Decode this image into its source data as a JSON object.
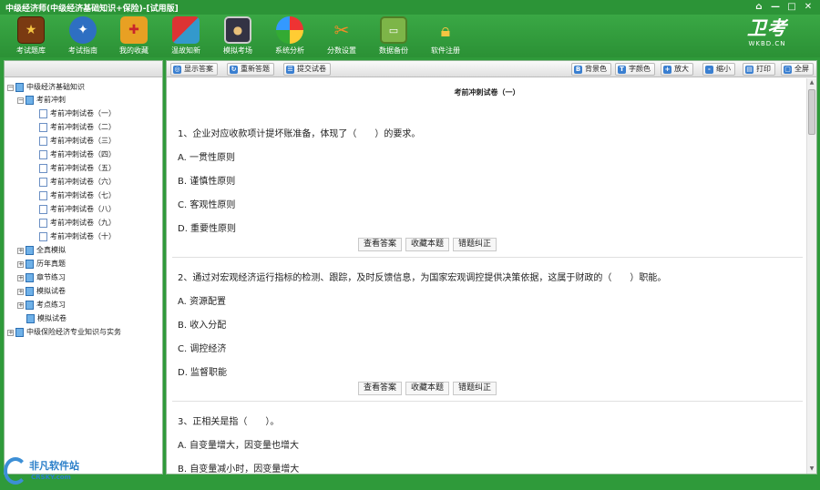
{
  "window": {
    "title": "中级经济师(中级经济基础知识+保险)-[试用版]",
    "controls": [
      "⌂",
      "—",
      "□",
      "✕"
    ]
  },
  "toolbar": {
    "items": [
      {
        "label": "考试题库",
        "icon": "book-icon"
      },
      {
        "label": "考试指南",
        "icon": "compass-icon"
      },
      {
        "label": "我的收藏",
        "icon": "gift-box-icon"
      },
      {
        "label": "温故知新",
        "icon": "cubes-icon"
      },
      {
        "label": "模拟考场",
        "icon": "monitor-person-icon"
      },
      {
        "label": "系统分析",
        "icon": "pie-chart-icon"
      },
      {
        "label": "分数设置",
        "icon": "tools-icon"
      },
      {
        "label": "数据备份",
        "icon": "disk-backup-icon"
      },
      {
        "label": "软件注册",
        "icon": "lock-icon"
      }
    ],
    "logo": {
      "main": "卫考",
      "sub": "WKBD.CN"
    }
  },
  "tree": {
    "root": "中级经济基础知识",
    "section": "考前冲刺",
    "papers": [
      "考前冲刺试卷（一）",
      "考前冲刺试卷（二）",
      "考前冲刺试卷（三）",
      "考前冲刺试卷（四）",
      "考前冲刺试卷（五）",
      "考前冲刺试卷（六）",
      "考前冲刺试卷（七）",
      "考前冲刺试卷（八）",
      "考前冲刺试卷（九）",
      "考前冲刺试卷（十）"
    ],
    "folders": [
      "全真模拟",
      "历年真题",
      "章节练习",
      "模拟试卷",
      "考点练习",
      "模拟试卷"
    ],
    "root2": "中级保险经济专业知识与实务"
  },
  "rtoolbar": {
    "left": [
      {
        "label": "显示答案",
        "icon": "◎"
      },
      {
        "label": "重新答题",
        "icon": "↻"
      },
      {
        "label": "提交试卷",
        "icon": "☰"
      }
    ],
    "right": [
      {
        "label": "背景色",
        "icon": "B"
      },
      {
        "label": "字颜色",
        "icon": "T"
      },
      {
        "label": "放大",
        "icon": "+"
      },
      {
        "label": "缩小",
        "icon": "-"
      },
      {
        "label": "打印",
        "icon": "▤"
      },
      {
        "label": "全屏",
        "icon": "▢"
      }
    ]
  },
  "paper": {
    "title": "考前冲刺试卷（一）",
    "action_labels": [
      "查看答案",
      "收藏本题",
      "错题纠正"
    ],
    "questions": [
      {
        "text": "1、企业对应收款项计提坏账准备，体现了（　　）的要求。",
        "options": [
          "A.  一贯性原则",
          "B.  谨慎性原则",
          "C.  客观性原则",
          "D.  重要性原则"
        ]
      },
      {
        "text": "2、通过对宏观经济运行指标的检测、跟踪，及时反馈信息，为国家宏观调控提供决策依据，这属于财政的（　　）职能。",
        "options": [
          "A.  资源配置",
          "B.  收入分配",
          "C.  调控经济",
          "D.  监督职能"
        ]
      },
      {
        "text": "3、正相关是指（　　）。",
        "options": [
          "A.  自变量增大，因变量也增大",
          "B.  自变量减小时，因变量增大"
        ]
      }
    ]
  },
  "watermark": {
    "line1": "非凡软件站",
    "line2": "CRSKY.com"
  },
  "colors": {
    "brand_green": "#2f9a3a",
    "accent_blue": "#3a7fd0"
  }
}
